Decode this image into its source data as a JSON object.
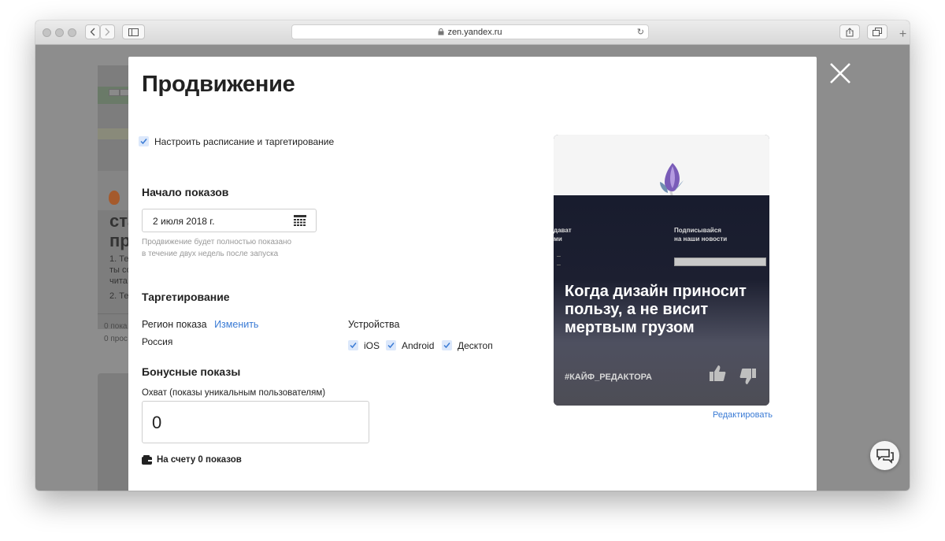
{
  "browser": {
    "url": "zen.yandex.ru"
  },
  "background": {
    "fragments": [
      "ста",
      "пр",
      "1. Те",
      "ты со",
      "чита",
      "2. Те",
      "0 пока",
      "0 прос"
    ]
  },
  "modal": {
    "title": "Продвижение",
    "schedule_checkbox_label": "Настроить расписание и таргетирование",
    "start": {
      "heading": "Начало показов",
      "date_value": "2 июля 2018 г.",
      "hint_line1": "Продвижение будет полностью показано",
      "hint_line2": "в течение двух недель после запуска"
    },
    "targeting": {
      "heading": "Таргетирование",
      "region_label": "Регион показа",
      "region_change": "Изменить",
      "region_value": "Россия",
      "devices_label": "Устройства",
      "devices": [
        "iOS",
        "Android",
        "Десктоп"
      ]
    },
    "bonus": {
      "heading": "Бонусные показы",
      "reach_label": "Охват (показы уникальным пользователям)",
      "reach_value": "0",
      "balance": "На счету 0 показов"
    },
    "preview": {
      "left_text_line1": "дават",
      "left_text_line2": "ми",
      "subscribe_line1": "Подписывайся",
      "subscribe_line2": "на наши новости",
      "headline": "Когда дизайн приносит пользу, а не висит мертвым грузом",
      "tag": "#КАЙФ_РЕДАКТОРА",
      "edit_link": "Редактировать"
    }
  },
  "colors": {
    "accent": "#3a7bd5",
    "checkbox_bg": "#dce8fb",
    "overlay": "#8d8d8d"
  }
}
